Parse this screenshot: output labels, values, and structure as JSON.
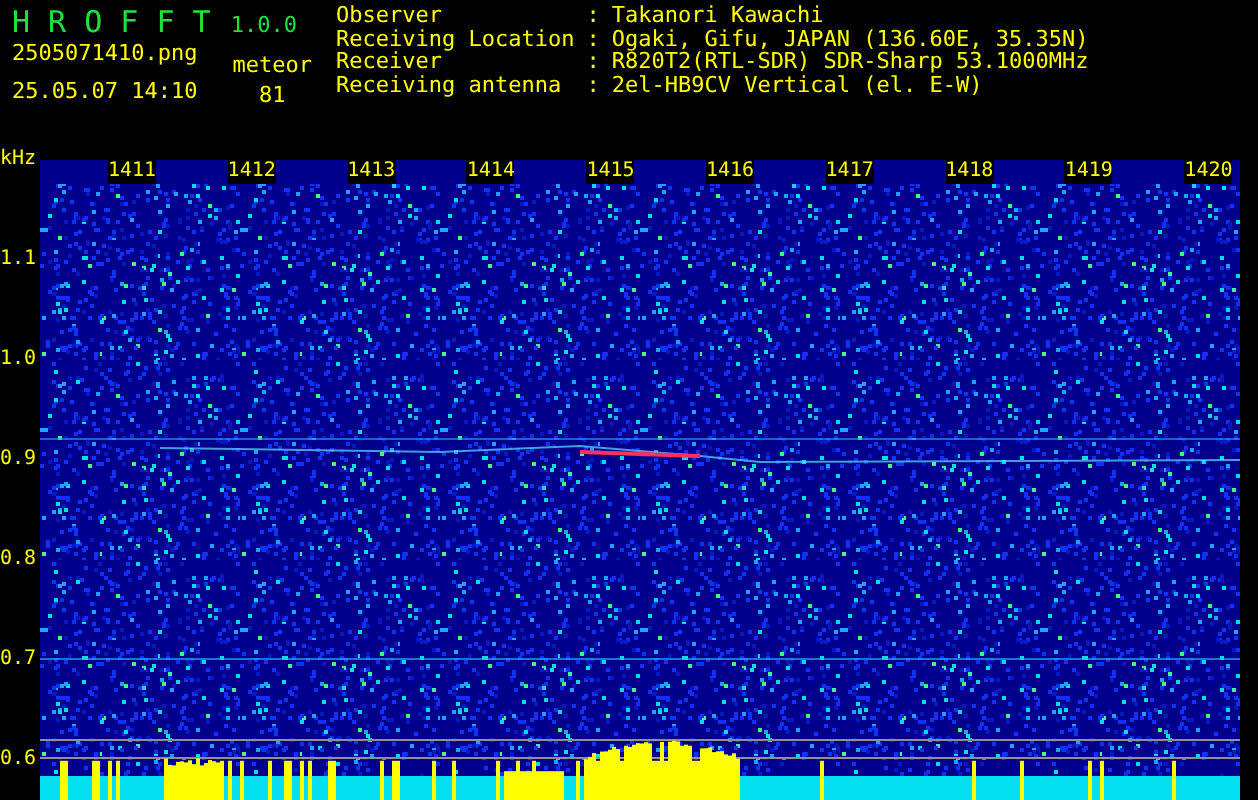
{
  "app": {
    "name": "H R O F F T",
    "version": "1.0.0"
  },
  "file": {
    "filename": "2505071410.png",
    "datetime": "25.05.07 14:10",
    "count_label": "meteor",
    "count": "81"
  },
  "info_separator": ":",
  "info": [
    {
      "label": "Observer",
      "value": "Takanori Kawachi"
    },
    {
      "label": "Receiving Location",
      "value": "Ogaki, Gifu, JAPAN (136.60E, 35.35N)"
    },
    {
      "label": "Receiver",
      "value": "R820T2(RTL-SDR) SDR-Sharp 53.1000MHz"
    },
    {
      "label": "Receiving antenna",
      "value": "2el-HB9CV Vertical (el. E-W)"
    }
  ],
  "spectrogram": {
    "y_unit": "kHz",
    "time_labels": [
      "1411",
      "1412",
      "1413",
      "1414",
      "1415",
      "1416",
      "1417",
      "1418",
      "1419",
      "1420"
    ],
    "freq_labels": [
      "1.1",
      "1.0",
      "0.9",
      "0.8",
      "0.7",
      "0.6"
    ]
  }
}
